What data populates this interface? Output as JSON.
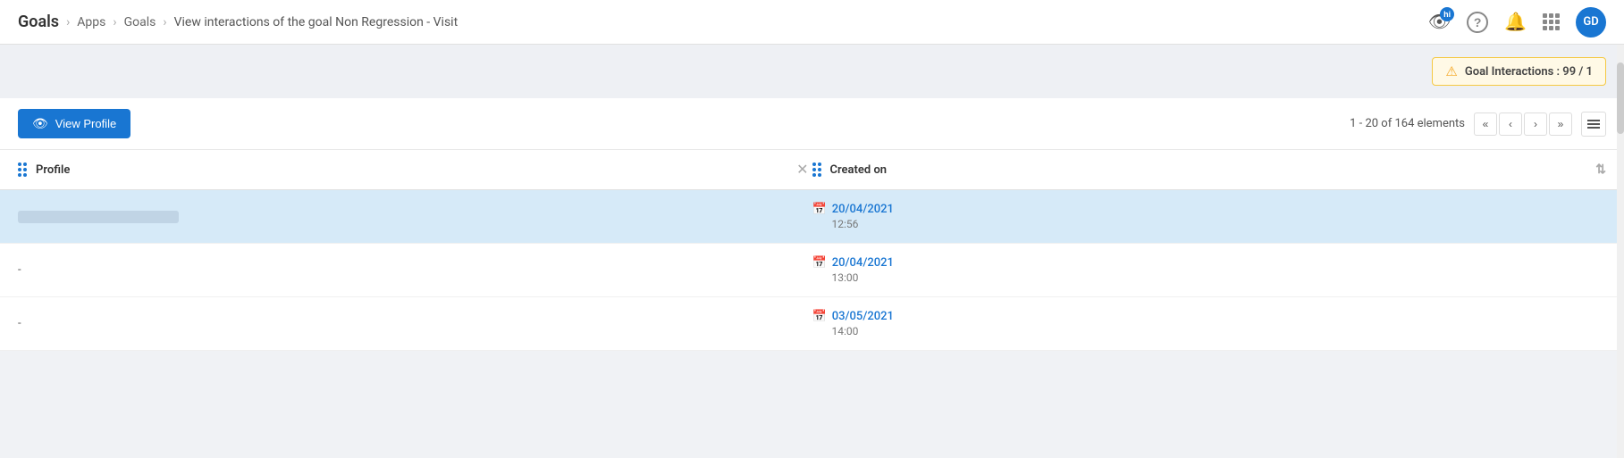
{
  "header": {
    "title": "Goals",
    "breadcrumbs": [
      {
        "label": "Apps",
        "id": "apps"
      },
      {
        "label": "Goals",
        "id": "goals"
      },
      {
        "label": "View interactions of the goal Non Regression - Visit",
        "id": "current"
      }
    ],
    "icons": {
      "camera_badge": "hi",
      "help_label": "?",
      "bell_label": "🔔",
      "grid_label": "⠿",
      "avatar_label": "GD"
    }
  },
  "goal_interactions_badge": {
    "text": "Goal Interactions : 99 / 1"
  },
  "toolbar": {
    "view_profile_label": "View Profile",
    "pagination_info": "1 - 20 of 164 elements"
  },
  "table": {
    "columns": [
      {
        "id": "profile",
        "label": "Profile"
      },
      {
        "id": "created_on",
        "label": "Created on"
      }
    ],
    "rows": [
      {
        "profile_type": "blurred",
        "created_date": "20/04/2021",
        "created_time": "12:56",
        "highlighted": true
      },
      {
        "profile_type": "dash",
        "profile_value": "-",
        "created_date": "20/04/2021",
        "created_time": "13:00",
        "highlighted": false
      },
      {
        "profile_type": "dash",
        "profile_value": "-",
        "created_date": "03/05/2021",
        "created_time": "14:00",
        "highlighted": false
      }
    ]
  }
}
